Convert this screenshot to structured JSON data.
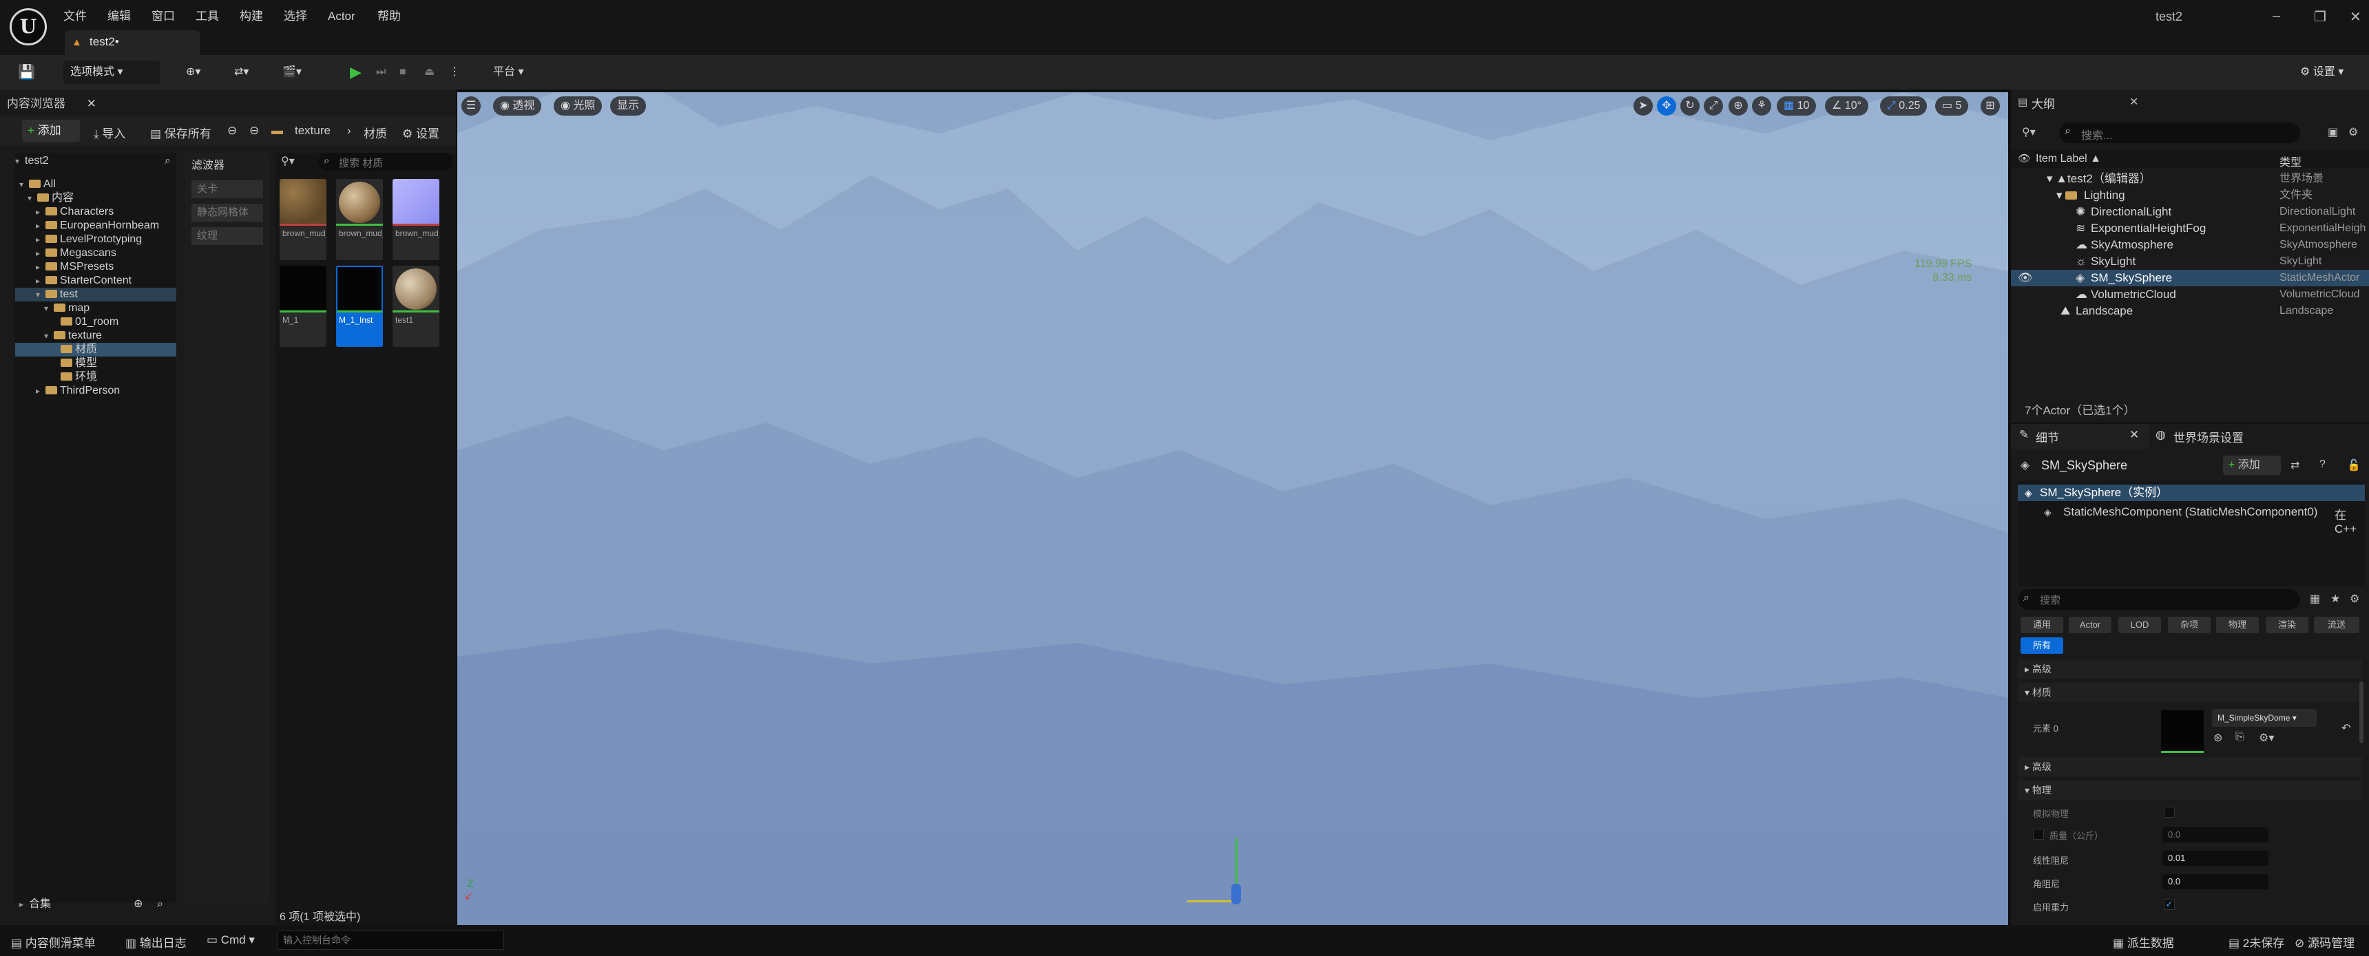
{
  "menu": {
    "items": [
      "文件",
      "编辑",
      "窗口",
      "工具",
      "构建",
      "选择",
      "Actor",
      "帮助"
    ]
  },
  "titlebar": {
    "doc_tab": "test2•",
    "project": "test2"
  },
  "toolbar": {
    "select_mode": "选项模式",
    "platform": "平台",
    "settings": "设置"
  },
  "content_browser": {
    "tab": "内容浏览器",
    "add": "添加",
    "import": "导入",
    "save_all": "保存所有",
    "path": [
      "texture",
      "材质"
    ],
    "settings": "设置",
    "tree_root": "test2",
    "tree": [
      "All",
      "内容",
      "Characters",
      "EuropeanHornbeam",
      "LevelPrototyping",
      "Megascans",
      "MSPresets",
      "StarterContent",
      "test",
      "map",
      "01_room",
      "texture",
      "材质",
      "模型",
      "环境",
      "ThirdPerson"
    ],
    "filter_title": "滤波器",
    "filters": [
      "关卡",
      "静态网格体",
      "纹理"
    ],
    "search_placeholder": "搜索 材质",
    "assets": [
      "brown_mud_dr",
      "brown_mud_dr",
      "brown_mud_dr",
      "M_1",
      "M_1_Inst",
      "test1"
    ],
    "count": "6 项(1 项被选中)",
    "collections": "合集"
  },
  "viewport": {
    "buttons": [
      "透视",
      "光照",
      "显示"
    ],
    "grid": "10",
    "angle": "10°",
    "scale": "0.25",
    "camera": "5",
    "fps": "119.99 FPS",
    "ms": "8.33 ms"
  },
  "outliner": {
    "tab": "大纲",
    "search_placeholder": "搜索...",
    "col_label": "Item Label ▲",
    "col_type": "类型",
    "rows": [
      {
        "label": "test2（编辑器）",
        "type": "世界场景"
      },
      {
        "label": "Lighting",
        "type": "文件夹"
      },
      {
        "label": "DirectionalLight",
        "type": "DirectionalLight"
      },
      {
        "label": "ExponentialHeightFog",
        "type": "ExponentialHeigh"
      },
      {
        "label": "SkyAtmosphere",
        "type": "SkyAtmosphere"
      },
      {
        "label": "SkyLight",
        "type": "SkyLight"
      },
      {
        "label": "SM_SkySphere",
        "type": "StaticMeshActor"
      },
      {
        "label": "VolumetricCloud",
        "type": "VolumetricCloud"
      },
      {
        "label": "Landscape",
        "type": "Landscape"
      }
    ],
    "count": "7个Actor（已选1个）"
  },
  "details": {
    "tab": "细节",
    "tab2": "世界场景设置",
    "actor": "SM_SkySphere",
    "add": "添加",
    "instance": "SM_SkySphere（实例）",
    "component": "StaticMeshComponent (StaticMeshComponent0)",
    "component_tail": "在C++",
    "search_placeholder": "搜索",
    "categories": [
      "通用",
      "Actor",
      "LOD",
      "杂项",
      "物理",
      "渲染",
      "流送",
      "所有"
    ],
    "sections": [
      "高级",
      "材质",
      "高级",
      "物理"
    ],
    "element": "元素 0",
    "material": "M_SimpleSkyDome",
    "props": [
      {
        "label": "模拟物理",
        "value": ""
      },
      {
        "label": "质量（公斤）",
        "value": "0.0"
      },
      {
        "label": "线性阻尼",
        "value": "0.01"
      },
      {
        "label": "角阻尼",
        "value": "0.0"
      },
      {
        "label": "启用重力",
        "value": ""
      }
    ]
  },
  "statusbar": {
    "drawer": "内容侧滑菜单",
    "log": "输出日志",
    "cmd": "Cmd",
    "cmd_placeholder": "输入控制台命令",
    "derived": "派生数据",
    "unsaved": "2未保存",
    "source": "源码管理"
  }
}
